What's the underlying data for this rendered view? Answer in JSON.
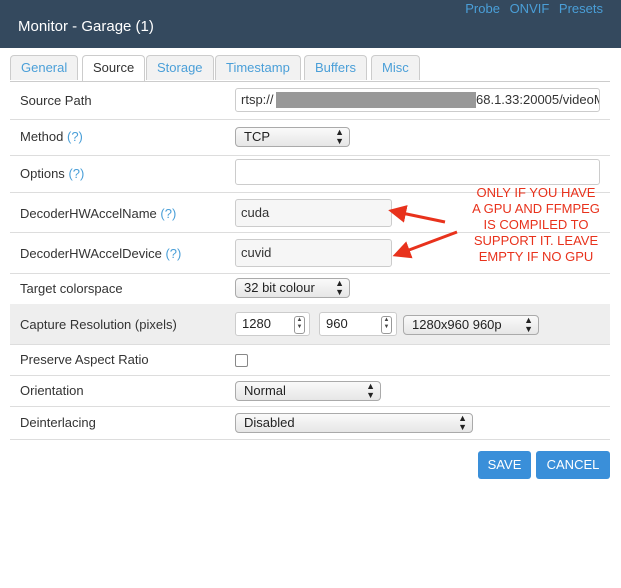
{
  "window": {
    "title": "Monitor - Garage (1)"
  },
  "top_links": [
    "Probe",
    "ONVIF",
    "Presets"
  ],
  "tabs": [
    "General",
    "Source",
    "Storage",
    "Timestamp",
    "Buffers",
    "Misc"
  ],
  "active_tab": "Source",
  "help_mark": "(?)",
  "form": {
    "source_path": {
      "label": "Source Path",
      "value_prefix": "rtsp://",
      "value_suffix": "68.1.33:20005/videoM"
    },
    "method": {
      "label": "Method",
      "value": "TCP"
    },
    "options": {
      "label": "Options",
      "value": ""
    },
    "decoder_name": {
      "label": "DecoderHWAccelName",
      "value": "cuda"
    },
    "decoder_device": {
      "label": "DecoderHWAccelDevice",
      "value": "cuvid"
    },
    "colorspace": {
      "label": "Target colorspace",
      "value": "32 bit colour"
    },
    "capture_res": {
      "label": "Capture Resolution (pixels)",
      "width": "1280",
      "height": "960",
      "preset": "1280x960 960p"
    },
    "aspect": {
      "label": "Preserve Aspect Ratio",
      "checked": false
    },
    "orientation": {
      "label": "Orientation",
      "value": "Normal"
    },
    "deinterlacing": {
      "label": "Deinterlacing",
      "value": "Disabled"
    }
  },
  "buttons": {
    "save": "SAVE",
    "cancel": "CANCEL"
  },
  "annotation": {
    "lines": [
      "ONLY IF YOU HAVE",
      "A GPU AND FFMPEG",
      "IS COMPILED TO",
      "SUPPORT IT. LEAVE",
      "EMPTY IF NO GPU"
    ],
    "color": "#e8321c"
  },
  "colors": {
    "titlebar": "#34495e",
    "link": "#4a9fd8",
    "button": "#3a8fd9"
  }
}
